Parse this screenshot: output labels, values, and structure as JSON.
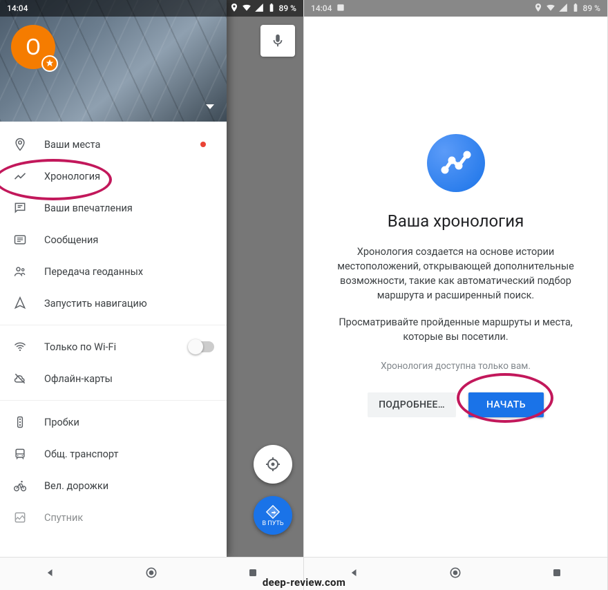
{
  "status": {
    "time": "14:04",
    "battery": "89 %"
  },
  "left": {
    "avatar_letter": "O",
    "fab_go_label": "В ПУТЬ",
    "menu": [
      {
        "icon": "pin-icon",
        "label": "Ваши места",
        "dot": true
      },
      {
        "icon": "timeline-icon",
        "label": "Хронология",
        "dot": false
      },
      {
        "icon": "reviews-icon",
        "label": "Ваши впечатления",
        "dot": false
      },
      {
        "icon": "messages-icon",
        "label": "Сообщения",
        "dot": false
      },
      {
        "icon": "share-loc-icon",
        "label": "Передача геоданных",
        "dot": false
      },
      {
        "icon": "nav-arrow-icon",
        "label": "Запустить навигацию",
        "dot": false
      }
    ],
    "menu2": [
      {
        "icon": "wifi-icon",
        "label": "Только по Wi-Fi",
        "switch": true
      },
      {
        "icon": "offline-icon",
        "label": "Офлайн-карты"
      }
    ],
    "menu3": [
      {
        "icon": "traffic-icon",
        "label": "Пробки"
      },
      {
        "icon": "transit-icon",
        "label": "Общ. транспорт"
      },
      {
        "icon": "bike-icon",
        "label": "Вел. дорожки"
      },
      {
        "icon": "sat-icon",
        "label": "Спутник"
      }
    ]
  },
  "right": {
    "title": "Ваша хронология",
    "desc1": "Хронология создается на основе истории местоположений, открывающей дополнительные возможности, такие как автоматический подбор маршрута и расширенный поиск.",
    "desc2": "Просматривайте пройденные маршруты и места, которые вы посетили.",
    "note": "Хронология доступна только вам.",
    "btn_more": "ПОДРОБНЕЕ…",
    "btn_start": "НАЧАТЬ"
  },
  "watermark": "deep-review.com"
}
